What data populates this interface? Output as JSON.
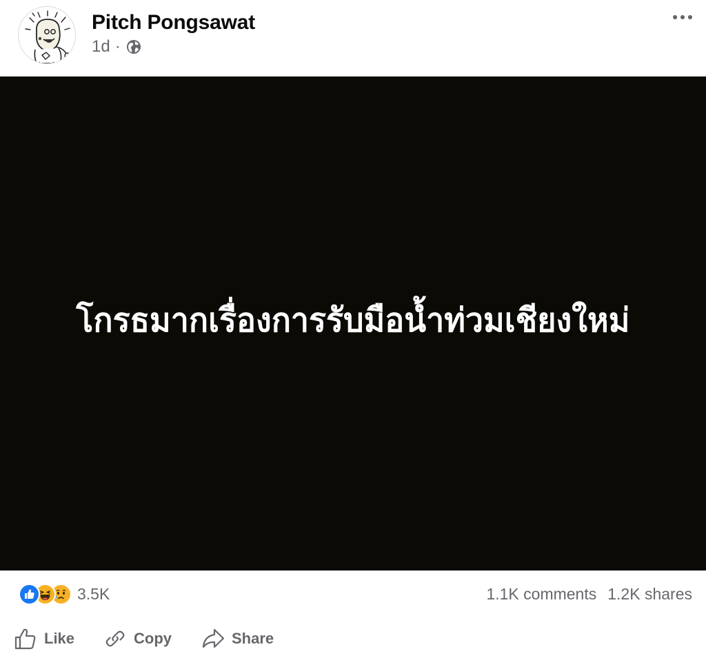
{
  "post": {
    "author": "Pitch Pongsawat",
    "time": "1d",
    "separator": "·",
    "privacy_icon": "globe-icon",
    "more_icon": "more-horizontal-icon"
  },
  "media": {
    "background": "#0c0a05",
    "text": "โกรธมากเรื่องการรับมือน้ำท่วมเชียงใหม่"
  },
  "stats": {
    "reaction_icons": [
      "like-icon",
      "haha-icon",
      "sad-icon"
    ],
    "reaction_count": "3.5K",
    "comments": "1.1K comments",
    "shares": "1.2K shares"
  },
  "actions": {
    "like": "Like",
    "copy": "Copy",
    "share": "Share"
  },
  "colors": {
    "facebook_blue": "#1877f2",
    "reaction_yellow": "#f7b125",
    "muted_text": "#65676b"
  }
}
